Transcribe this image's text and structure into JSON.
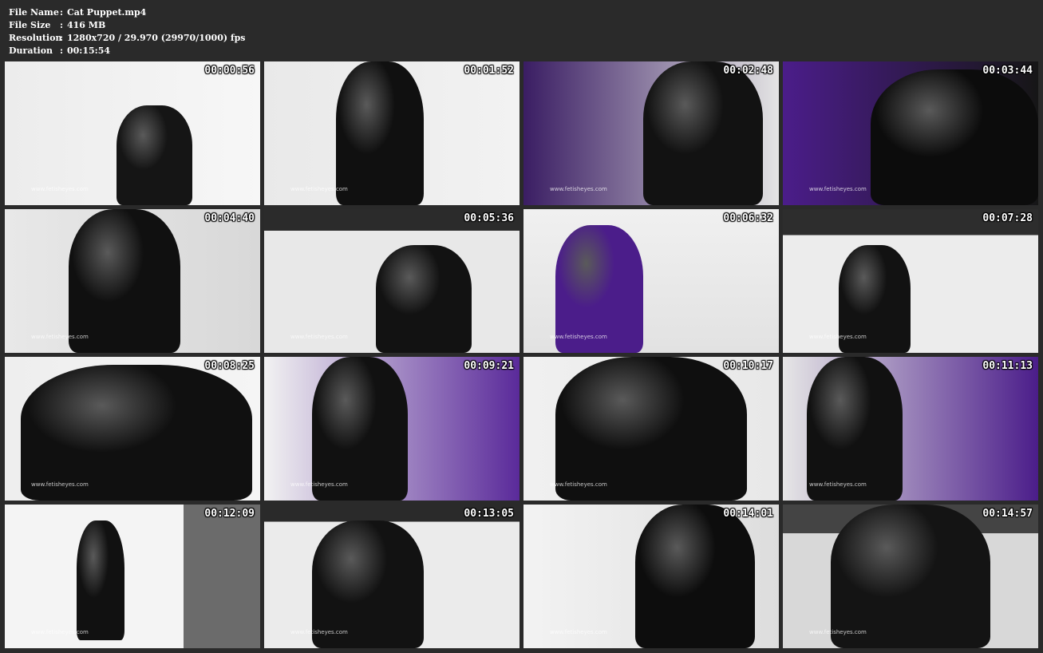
{
  "info": {
    "file_name_label": "File Name",
    "file_name": "Cat Puppet.mp4",
    "file_size_label": "File Size",
    "file_size": "416 MB",
    "resolution_label": "Resolution",
    "resolution": "1280x720 / 29.970 (29970/1000) fps",
    "duration_label": "Duration",
    "duration": "00:15:54",
    "separator": ":"
  },
  "thumbnails": [
    {
      "timestamp": "00:00:56",
      "watermark": "www.fetisheyes.com"
    },
    {
      "timestamp": "00:01:52",
      "watermark": "www.fetisheyes.com"
    },
    {
      "timestamp": "00:02:48",
      "watermark": "www.fetisheyes.com"
    },
    {
      "timestamp": "00:03:44",
      "watermark": "www.fetisheyes.com"
    },
    {
      "timestamp": "00:04:40",
      "watermark": "www.fetisheyes.com"
    },
    {
      "timestamp": "00:05:36",
      "watermark": "www.fetisheyes.com"
    },
    {
      "timestamp": "00:06:32",
      "watermark": "www.fetisheyes.com"
    },
    {
      "timestamp": "00:07:28",
      "watermark": "www.fetisheyes.com"
    },
    {
      "timestamp": "00:08:25",
      "watermark": "www.fetisheyes.com"
    },
    {
      "timestamp": "00:09:21",
      "watermark": "www.fetisheyes.com"
    },
    {
      "timestamp": "00:10:17",
      "watermark": "www.fetisheyes.com"
    },
    {
      "timestamp": "00:11:13",
      "watermark": "www.fetisheyes.com"
    },
    {
      "timestamp": "00:12:09",
      "watermark": "www.fetisheyes.com"
    },
    {
      "timestamp": "00:13:05",
      "watermark": "www.fetisheyes.com"
    },
    {
      "timestamp": "00:14:01",
      "watermark": "www.fetisheyes.com"
    },
    {
      "timestamp": "00:14:57",
      "watermark": "www.fetisheyes.com"
    }
  ],
  "colors": {
    "background": "#2a2a2a",
    "latex_black": "#111111",
    "latex_purple": "#4b1d8a",
    "studio_white": "#e6e6e6"
  }
}
